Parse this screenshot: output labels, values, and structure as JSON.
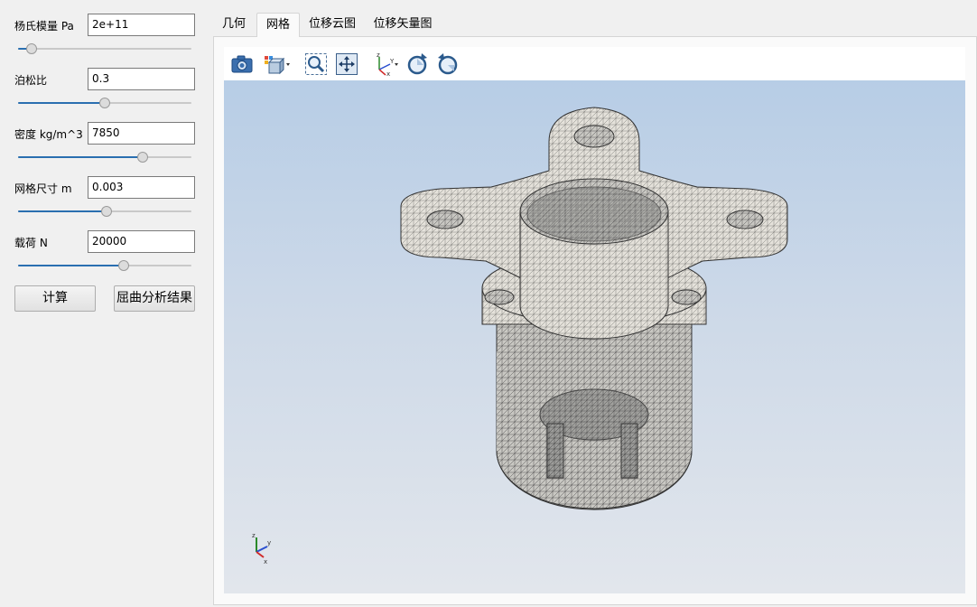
{
  "params": [
    {
      "label": "杨氏模量 Pa",
      "value": "2e+11",
      "slider_fraction": 0.08
    },
    {
      "label": "泊松比",
      "value": "0.3",
      "slider_fraction": 0.5
    },
    {
      "label": "密度 kg/m^3",
      "value": "7850",
      "slider_fraction": 0.72
    },
    {
      "label": "网格尺寸 m",
      "value": "0.003",
      "slider_fraction": 0.51
    },
    {
      "label": "载荷 N",
      "value": "20000",
      "slider_fraction": 0.61
    }
  ],
  "buttons": {
    "compute": "计算",
    "buckling": "屈曲分析结果"
  },
  "tabs": [
    {
      "label": "几何",
      "active": false
    },
    {
      "label": "网格",
      "active": true
    },
    {
      "label": "位移云图",
      "active": false
    },
    {
      "label": "位移矢量图",
      "active": false
    }
  ],
  "toolbar_icons": [
    "camera-icon",
    "view-cube-icon",
    "zoom-box-icon",
    "fit-all-icon",
    "axes-icon",
    "rotate-cw-icon",
    "rotate-ccw-icon"
  ],
  "axis_triad_labels": [
    "x",
    "y",
    "z"
  ],
  "colors": {
    "slider_fill": "#2a6fb0",
    "viewport_top": "#b7cde6",
    "viewport_bottom": "#e2e6ec"
  }
}
